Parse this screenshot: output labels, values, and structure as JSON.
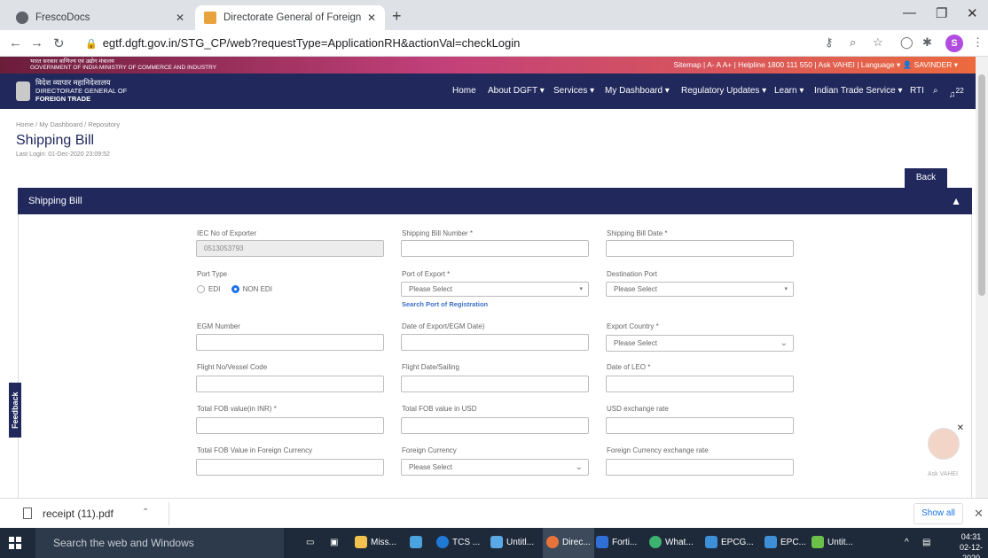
{
  "browser": {
    "tabs": [
      {
        "title": "FrescoDocs",
        "color": "#5f6368"
      },
      {
        "title": "Directorate General of Foreign Tr",
        "color": "#e8a33d"
      }
    ],
    "url": "egtf.dgft.gov.in/STG_CP/web?requestType=ApplicationRH&actionVal=checkLogin",
    "profile_initial": "S"
  },
  "gov_strip": {
    "left_text_hi": "भारत सरकार  वाणिज्य एवं उद्योग मंत्रालय",
    "left_text_en": "GOVERNMENT OF INDIA  MINISTRY OF COMMERCE AND INDUSTRY",
    "links": "Sitemap  |  A-  A  A+  |  Helpline 1800 111 550  |  Ask VAHEI  |  Language ▾   👤 SAVINDER ▾"
  },
  "header": {
    "brand_hi": "विदेश व्यापार महानिदेशालय",
    "brand_line2": "DIRECTORATE GENERAL OF",
    "brand_line3": "FOREIGN TRADE",
    "nav": [
      "Home",
      "About DGFT ▾",
      "Services ▾",
      "My Dashboard ▾",
      "Regulatory Updates ▾",
      "Learn ▾",
      "Indian Trade Service ▾",
      "RTI"
    ],
    "notification_count": "22"
  },
  "page": {
    "breadcrumb": "Home  /  My Dashboard  /  Repository",
    "title": "Shipping Bill",
    "last_login": "Last Login: 01-Dec-2020 23:09:52",
    "back_label": "Back",
    "section_title": "Shipping Bill"
  },
  "form": {
    "iec_label": "IEC No of Exporter",
    "iec_value": "0513053793",
    "sb_number_label": "Shipping Bill Number *",
    "sb_date_label": "Shipping Bill Date *",
    "port_type_label": "Port Type",
    "port_type_options": [
      "EDI",
      "NON EDI"
    ],
    "port_of_export_label": "Port of Export *",
    "port_of_export_value": "Please Select",
    "search_port_link": "Search Port of Registration",
    "destination_port_label": "Destination Port",
    "destination_port_value": "Please Select",
    "egm_number_label": "EGM Number",
    "egm_date_label": "Date of Export/EGM Date)",
    "export_country_label": "Export Country *",
    "export_country_value": "Please Select",
    "flight_label": "Flight No/Vessel Code",
    "flight_date_label": "Flight Date/Sailing",
    "leo_label": "Date of LEO *",
    "fob_inr_label": "Total FOB value(in INR) *",
    "fob_usd_label": "Total FOB value in USD",
    "usd_rate_label": "USD exchange rate",
    "fob_fc_label": "Total FOB Value in Foreign Currency",
    "foreign_currency_label": "Foreign Currency",
    "foreign_currency_value": "Please Select",
    "fc_rate_label": "Foreign Currency exchange rate"
  },
  "widgets": {
    "feedback": "Feedback",
    "assistant_label": "Ask VAHEI"
  },
  "downloads": {
    "file": "receipt (11).pdf",
    "show_all": "Show all"
  },
  "taskbar": {
    "search_placeholder": "Search the web and Windows",
    "items": [
      "Miss...",
      "TCS ...",
      "Untitl...",
      "Direc...",
      "Forti...",
      "What...",
      "EPCG...",
      "EPC...",
      "Untit..."
    ],
    "time": "04:31",
    "date": "02-12-2020"
  }
}
